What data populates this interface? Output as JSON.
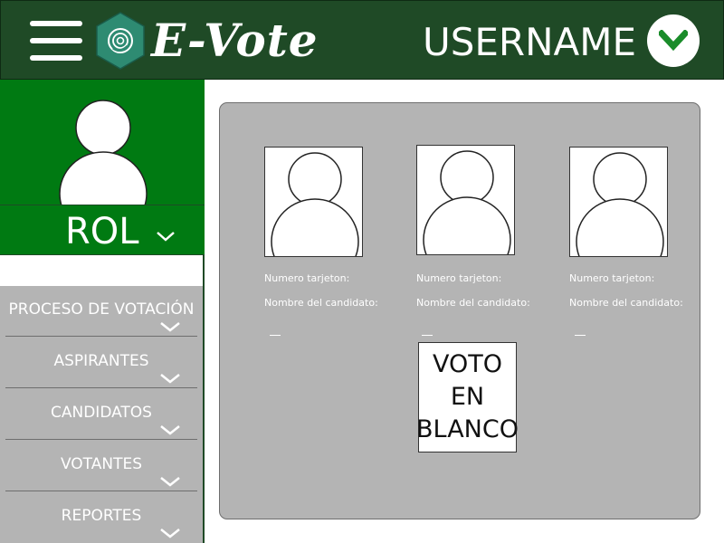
{
  "header": {
    "brand": "E-Vote",
    "username": "USERNAME",
    "icons": {
      "menu": "hamburger-icon",
      "logo": "fingerprint-logo-icon",
      "dropdown": "chevron-down-icon"
    },
    "colors": {
      "header_bg": "#1f4a26",
      "accent": "#007a12"
    }
  },
  "sidebar": {
    "role_label": "ROL",
    "menu": [
      {
        "label": "PROCESO DE VOTACIÓN"
      },
      {
        "label": "ASPIRANTES"
      },
      {
        "label": "CANDIDATOS"
      },
      {
        "label": "VOTANTES"
      },
      {
        "label": "REPORTES"
      }
    ]
  },
  "ballot": {
    "candidates": [
      {
        "number_label": "Numero tarjeton:",
        "name_label": "Nombre del candidato:"
      },
      {
        "number_label": "Numero tarjeton:",
        "name_label": "Nombre del candidato:"
      },
      {
        "number_label": "Numero tarjeton:",
        "name_label": "Nombre del candidato:"
      }
    ],
    "blank_vote_lines": [
      "VOTO",
      "EN",
      "BLANCO"
    ]
  }
}
